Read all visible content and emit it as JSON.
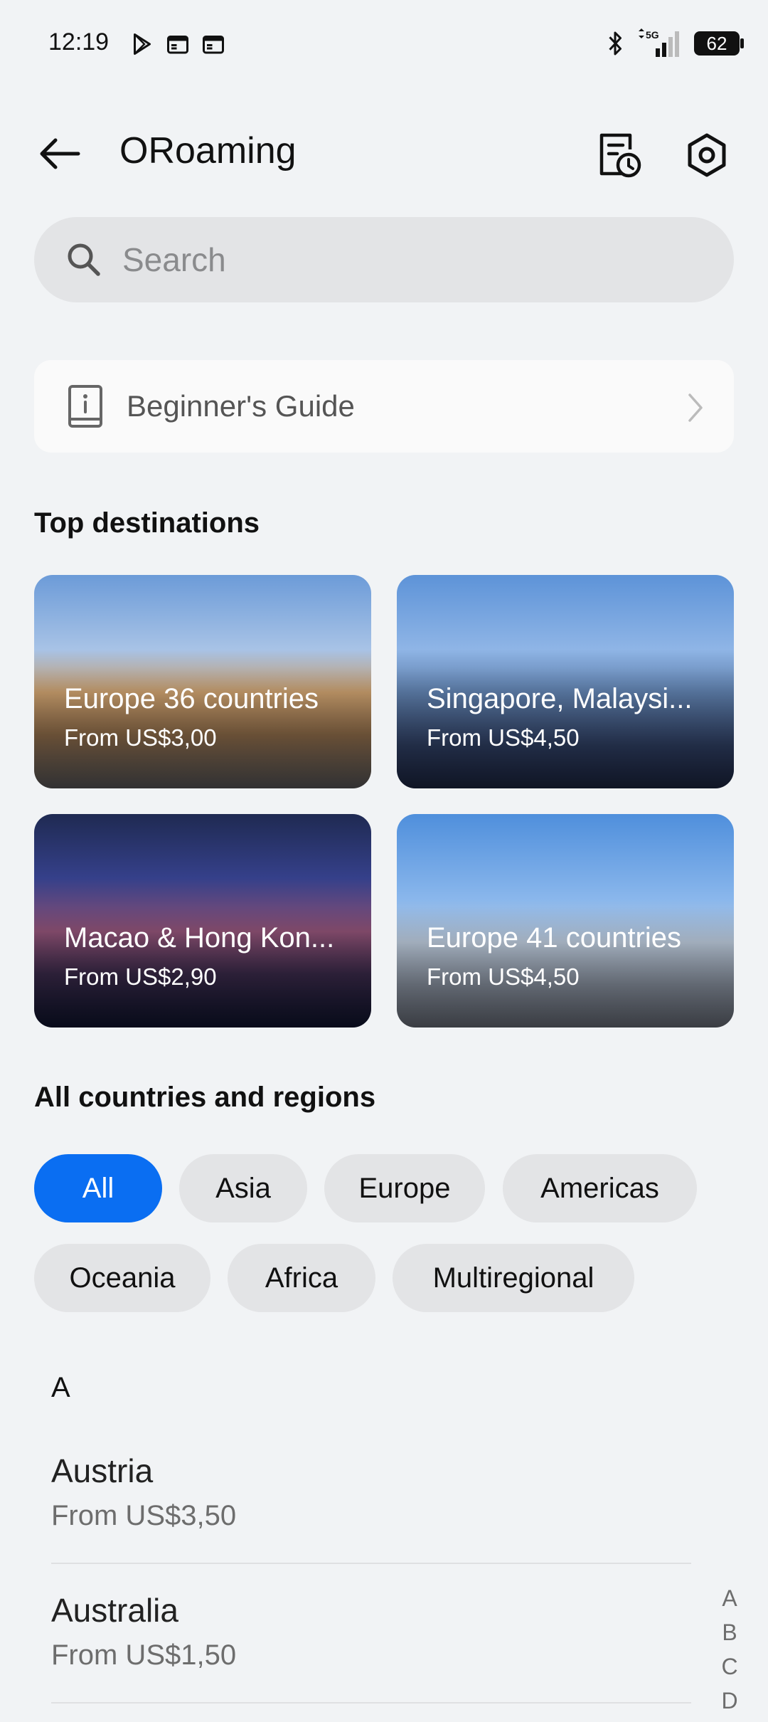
{
  "status_bar": {
    "time": "12:19",
    "left_icons": [
      "play-store-icon",
      "calendar-icon",
      "calendar-icon"
    ],
    "right_icons": [
      "bluetooth-icon",
      "5g-signal-icon"
    ],
    "network": "5G",
    "battery": "62"
  },
  "header": {
    "title": "ORoaming",
    "back_icon": "back-arrow-icon",
    "history_icon": "order-history-icon",
    "settings_icon": "settings-icon"
  },
  "search": {
    "placeholder": "Search"
  },
  "guide": {
    "label": "Beginner's Guide"
  },
  "top_destinations": {
    "title": "Top destinations",
    "cards": [
      {
        "name": "Europe 36 countries",
        "price": "From US$3,00"
      },
      {
        "name": "Singapore, Malaysi...",
        "price": "From US$4,50"
      },
      {
        "name": "Macao & Hong Kon...",
        "price": "From US$2,90"
      },
      {
        "name": "Europe 41 countries",
        "price": "From US$4,50"
      }
    ]
  },
  "regions": {
    "title": "All countries and regions",
    "chips": [
      "All",
      "Asia",
      "Europe",
      "Americas",
      "Oceania",
      "Africa",
      "Multiregional"
    ],
    "selected": "All"
  },
  "list": {
    "letter": "A",
    "items": [
      {
        "name": "Austria",
        "price": "From US$3,50"
      },
      {
        "name": "Australia",
        "price": "From US$1,50"
      }
    ]
  },
  "index_letters": [
    "A",
    "B",
    "C",
    "D"
  ],
  "colors": {
    "accent": "#0a6ef2",
    "background": "#f1f3f5",
    "chip": "#e3e4e6"
  }
}
